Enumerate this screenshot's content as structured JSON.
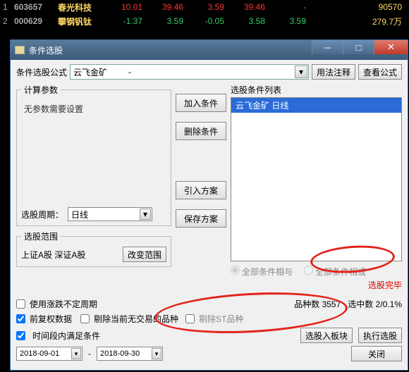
{
  "stocks": {
    "rows": [
      {
        "idx": "1",
        "code": "603657",
        "name": "春光科技",
        "c1": "10.01",
        "c2": "39.46",
        "c3": "3.59",
        "c4": "39.46",
        "c5": "-",
        "vol": "90570",
        "dir": "up"
      },
      {
        "idx": "2",
        "code": "000629",
        "name": "攀钢钒钛",
        "c1": "-1.37",
        "c2": "3.59",
        "c3": "-0.05",
        "c4": "3.58",
        "c5": "3.59",
        "vol": "279.7万",
        "dir": "down"
      }
    ]
  },
  "dialog": {
    "title": "条件选股",
    "formula_label": "条件选股公式",
    "formula_value": "云飞金矿",
    "formula_sep": "-",
    "usage_btn": "用法注释",
    "view_btn": "查看公式",
    "calc_legend": "计算参数",
    "no_params": "无参数需要设置",
    "period_label": "选股周期：",
    "period_value": "日线",
    "range_legend": "选股范围",
    "range_text": "上证A股  深证A股",
    "change_range_btn": "改变范围",
    "mid": {
      "add": "加入条件",
      "del": "删除条件",
      "import": "引入方案",
      "save": "保存方案"
    },
    "list_header": "选股条件列表",
    "list_item": "云飞金矿   日线",
    "radio_all": "全部条件相与",
    "radio_or": "全部条件相或",
    "status": "选股完毕",
    "chk_unstable": "使用涨跌不定周期",
    "stats_count_label": "品种数",
    "stats_count": "3557",
    "stats_sel_label": "选中数",
    "stats_sel": "2/0.1%",
    "chk_fq": "前复权数据",
    "chk_excl": "剔除当前无交易的品种",
    "chk_st": "剔除ST品种",
    "chk_date": "时间段内满足条件",
    "date_from": "2018-09-01",
    "date_to": "2018-09-30",
    "to_block_btn": "选股入板块",
    "exec_btn": "执行选股",
    "close_btn": "关闭"
  }
}
